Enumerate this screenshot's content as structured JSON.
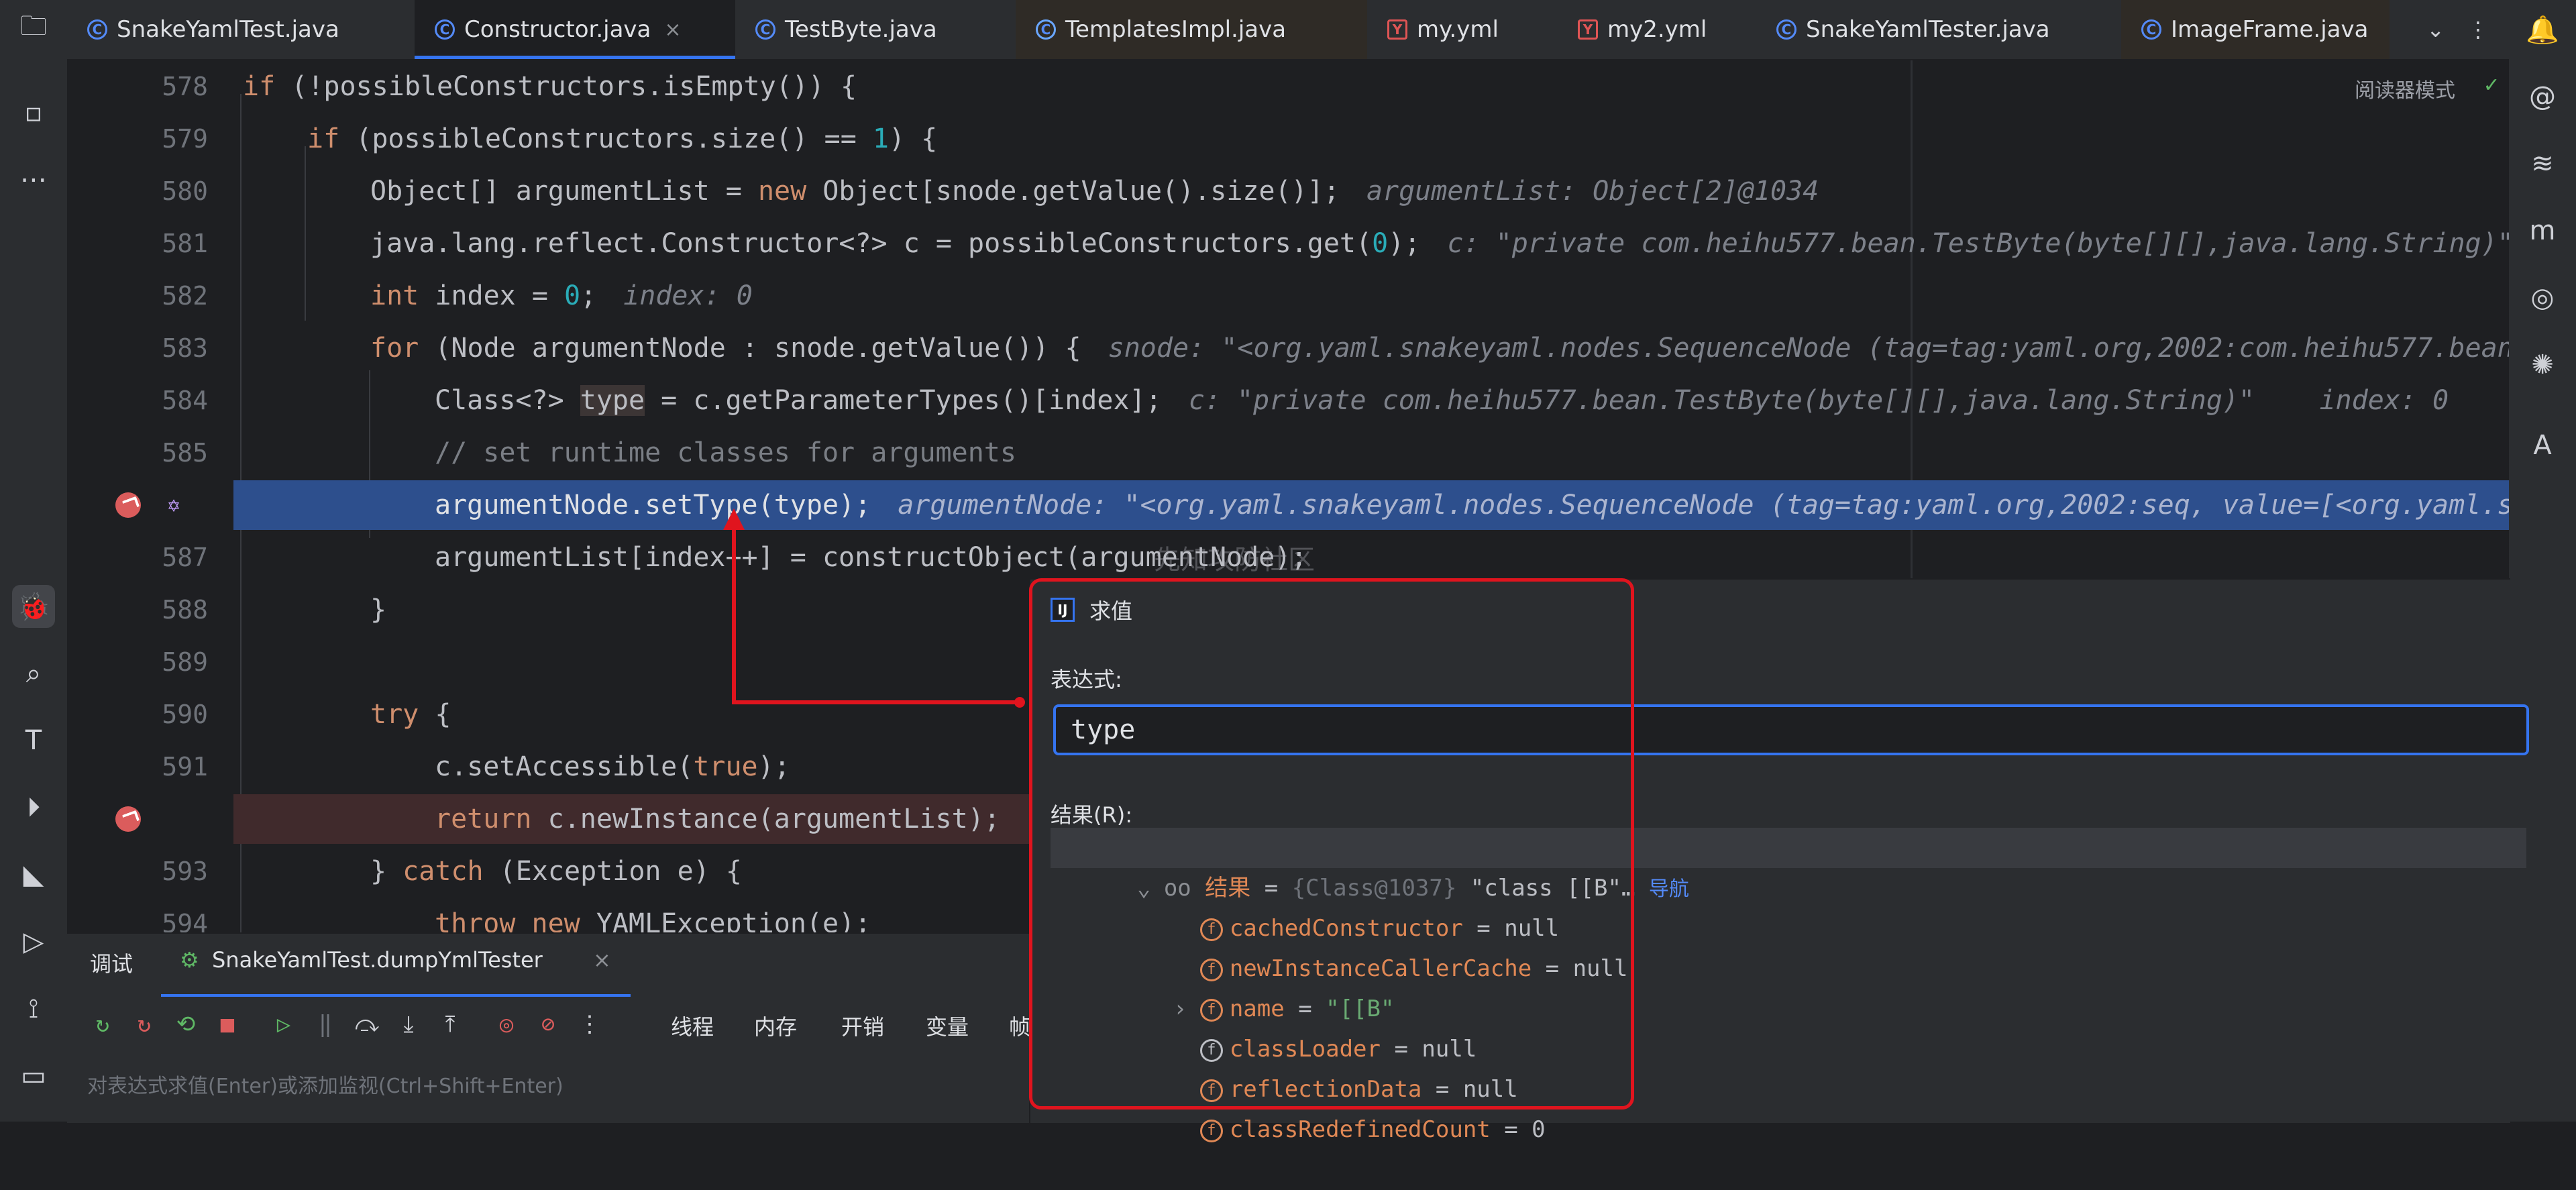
{
  "tabs": [
    {
      "label": "SnakeYamlTest.java",
      "icon": "java-class-icon",
      "active": false
    },
    {
      "label": "Constructor.java",
      "icon": "java-class-icon",
      "active": true
    },
    {
      "label": "TestByte.java",
      "icon": "java-class-icon",
      "active": false
    },
    {
      "label": "TemplatesImpl.java",
      "icon": "java-class-icon",
      "active": false
    },
    {
      "label": "my.yml",
      "icon": "yaml-icon",
      "active": false
    },
    {
      "label": "my2.yml",
      "icon": "yaml-icon",
      "active": false
    },
    {
      "label": "SnakeYamlTester.java",
      "icon": "java-class-icon",
      "active": false
    },
    {
      "label": "ImageFrame.java",
      "icon": "java-class-icon",
      "active": false
    }
  ],
  "editor": {
    "reader_mode": "阅读器模式",
    "lines": [
      {
        "num": "578"
      },
      {
        "num": "579"
      },
      {
        "num": "580"
      },
      {
        "num": "581"
      },
      {
        "num": "582"
      },
      {
        "num": "583"
      },
      {
        "num": "584"
      },
      {
        "num": "585"
      },
      {
        "num": ""
      },
      {
        "num": "587"
      },
      {
        "num": "588"
      },
      {
        "num": "589"
      },
      {
        "num": "590"
      },
      {
        "num": "591"
      },
      {
        "num": ""
      },
      {
        "num": "593"
      },
      {
        "num": "594"
      }
    ],
    "code": {
      "l578a": "if",
      "l578b": " (!possibleConstructors.isEmpty()) {",
      "l579a": "if",
      "l579b": " (possibleConstructors.size() == ",
      "l579c": "1",
      "l579d": ") {",
      "l580a": "Object[] argumentList = ",
      "l580b": "new",
      "l580c": " Object[snode.getValue().size()];",
      "l580h": "argumentList: Object[2]@1034",
      "l581a": "java.lang.reflect.Constructor<?> c = possibleConstructors.get(",
      "l581b": "0",
      "l581c": ");",
      "l581h": "c: \"private com.heihu577.bean.TestByte(byte[][],java.lang.String)\"",
      "l582a": "int",
      "l582b": " index = ",
      "l582c": "0",
      "l582d": ";",
      "l582h": "index: 0",
      "l583a": "for",
      "l583b": " (Node argumentNode : snode.getValue()) {",
      "l583h": "snode: \"<org.yaml.snakeyaml.nodes.SequenceNode (tag=tag:yaml.org,2002:com.heihu577.bean",
      "l584a": "Class<?> ",
      "l584b": "type",
      "l584c": " = c.getParameterTypes()[index];",
      "l584h": "c: \"private com.heihu577.bean.TestByte(byte[][],java.lang.String)\"    index: 0",
      "l585": "// set runtime classes for arguments",
      "l586a": "argumentNode.setType(type);",
      "l586h": "argumentNode: \"<org.yaml.snakeyaml.nodes.SequenceNode (tag=tag:yaml.org,2002:seq, value=[<org.yaml.s",
      "l587": "argumentList[index++] = constructObject(argumentNode);",
      "l588": "}",
      "l590a": "try",
      "l590b": " {",
      "l591a": "c.setAccessible(",
      "l591b": "true",
      "l591c": ");",
      "l592a": "return",
      "l592b": " c.newInstance(argumentList);",
      "l593a": "} ",
      "l593b": "catch",
      "l593c": " (Exception e) {",
      "l594a": "throw new",
      "l594b": " YAMLException(e);"
    }
  },
  "debug": {
    "tab_debug": "调试",
    "tab_session": "SnakeYamlTest.dumpYmlTester",
    "toolbar_labels": [
      "线程",
      "内存",
      "开销",
      "变量",
      "帧"
    ],
    "eval_placeholder": "对表达式求值(Enter)或添加监视(Ctrl+Shift+Enter)"
  },
  "evaluate": {
    "title": "求值",
    "expr_label": "表达式:",
    "expression": "type",
    "result_label": "结果(R):",
    "result": {
      "name": "结果",
      "eq": " = ",
      "ref": "{Class@1037}",
      "value": " \"class [[B\"…",
      "nav": "导航"
    },
    "fields": [
      {
        "name": "cachedConstructor",
        "value": " = null",
        "expandable": false
      },
      {
        "name": "newInstanceCallerCache",
        "value": " = null",
        "expandable": false
      },
      {
        "name": "name",
        "value": "\"[[B\"",
        "expandable": true
      },
      {
        "name": "classLoader",
        "value": " = null",
        "expandable": false
      },
      {
        "name": "reflectionData",
        "value": " = null",
        "expandable": false
      },
      {
        "name": "classRedefinedCount",
        "value": " = 0",
        "expandable": false
      }
    ]
  },
  "watermark": "先知攻防社区",
  "colors": {
    "accent": "#3574f0",
    "highlight": "#2d4f8d",
    "annotation": "#e0141e",
    "breakpoint": "#db5c5c"
  }
}
